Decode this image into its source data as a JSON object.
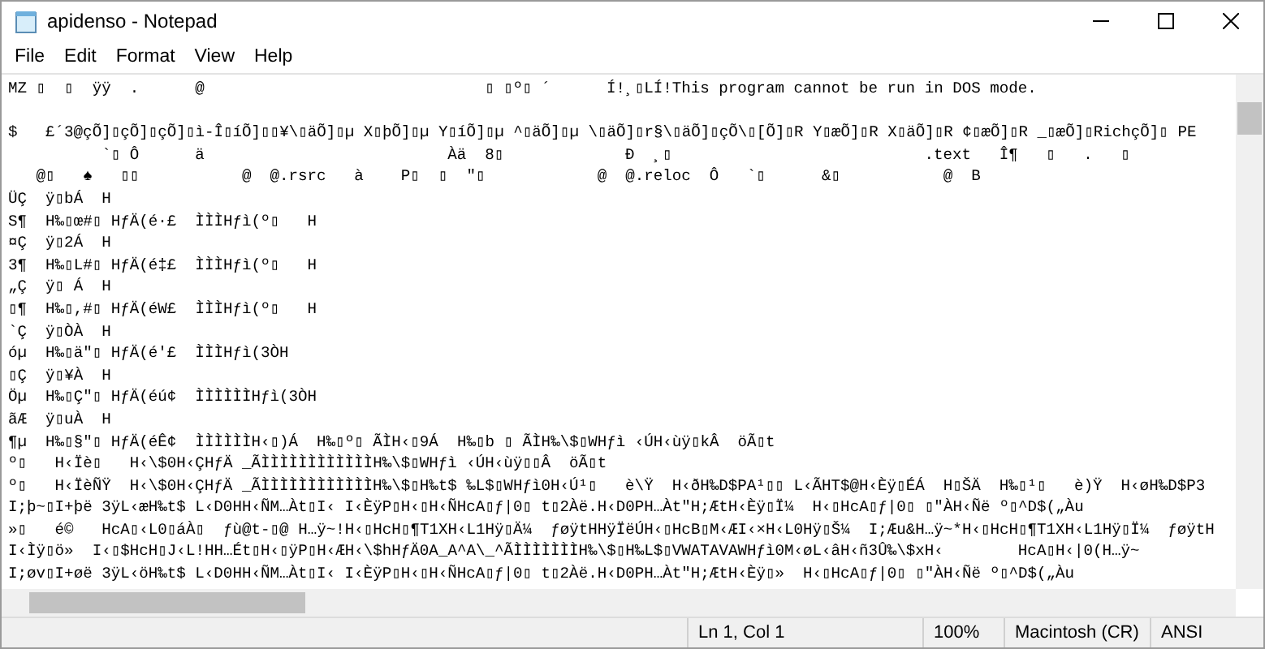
{
  "window": {
    "title": "apidenso - Notepad"
  },
  "menu": [
    "File",
    "Edit",
    "Format",
    "View",
    "Help"
  ],
  "editor": {
    "lines": [
      {
        "text": "MZ ▯  ▯  ÿÿ  .      @                              ▯ ▯º▯ ´      Í!¸▯LÍ!This program cannot be run in DOS mode.",
        "gap_after": true
      },
      {
        "text": "$   £´3@çÕ]▯çÕ]▯çÕ]▯ì-Î▯íÕ]▯▯¥\\▯äÕ]▯µ X▯þÕ]▯µ Y▯íÕ]▯µ ^▯äÕ]▯µ \\▯äÕ]▯r§\\▯äÕ]▯çÕ\\▯[Õ]▯R Y▯æÕ]▯R X▯äÕ]▯R ¢▯æÕ]▯R _▯æÕ]▯RichçÕ]▯ PE"
      },
      {
        "text": "          `▯ Ô      ä                          Àä  8▯             Ð  ¸▯                           .text   Î¶   ▯   .   ▯"
      },
      {
        "text": "   @▯   ♠   ▯▯           @  @.rsrc   à    P▯  ▯  \"▯            @  @.reloc  Ô   `▯      &▯           @  B"
      },
      {
        "text": "ÜÇ  ÿ▯bÁ  H"
      },
      {
        "text": "S¶  H‰▯œ#▯ HƒÄ(é·£  ÌÌÌHƒì(º▯   H"
      },
      {
        "text": "¤Ç  ÿ▯2Á  H"
      },
      {
        "text": "3¶  H‰▯L#▯ HƒÄ(é‡£  ÌÌÌHƒì(º▯   H"
      },
      {
        "text": "„Ç  ÿ▯ Á  H"
      },
      {
        "text": "▯¶  H‰▯,#▯ HƒÄ(éW£  ÌÌÌHƒì(º▯   H"
      },
      {
        "text": "`Ç  ÿ▯ÒÀ  H"
      },
      {
        "text": "óµ  H‰▯ä\"▯ HƒÄ(é'£  ÌÌÌHƒì(3ÒH"
      },
      {
        "text": "▯Ç  ÿ▯¥À  H"
      },
      {
        "text": "Öµ  H‰▯Ç\"▯ HƒÄ(éú¢  ÌÌÌÌÌÌHƒì(3ÒH"
      },
      {
        "text": "ãÆ  ÿ▯uÀ  H"
      },
      {
        "text": "¶µ  H‰▯§\"▯ HƒÄ(éÊ¢  ÌÌÌÌÌÌH‹▯)Á  H‰▯º▯ ÃÌH‹▯9Á  H‰▯b ▯ ÃÌH‰\\$▯WHƒì ‹ÚH‹ùÿ▯kÂ  öÃ▯t"
      },
      {
        "text": "º▯   H‹Ïè▯   H‹\\$0H‹ÇHƒÄ _ÃÌÌÌÌÌÌÌÌÌÌÌÌH‰\\$▯WHƒì ‹ÚH‹ùÿ▯▯Â  öÃ▯t"
      },
      {
        "text": "º▯   H‹ÏèÑŸ  H‹\\$0H‹ÇHƒÄ _ÃÌÌÌÌÌÌÌÌÌÌÌÌH‰\\$▯H‰t$ ‰L$▯WHƒì0H‹Ú¹▯   è\\Ÿ  H‹ðH‰D$PA¹▯▯ L‹ÃHT$@H‹Èÿ▯ÉÁ  H▯ŠÄ  H‰▯¹▯   è)Ÿ  H‹øH‰D$P3"
      },
      {
        "text": "I;þ~▯I+þë 3ÿL‹æH‰t$ L‹D0HH‹ÑM…Àt▯I‹ I‹ÈÿP▯H‹▯H‹ÑHcA▯ƒ|0▯ t▯2Àë.H‹D0PH…Àt\"H;ÆtH‹Èÿ▯Ï¼  H‹▯HcA▯ƒ|0▯ ▯\"ÀH‹Ñë º▯^D$(„Àu"
      },
      {
        "text": "»▯   é©   HcA▯‹L0▯áÀ▯  ƒù@t-▯@ H…ÿ~!H‹▯HcH▯¶T1XH‹L1Hÿ▯Ä¼  ƒøÿtHHÿÏëÚH‹▯HcB▯M‹ÆI‹×H‹L0Hÿ▯Š¼  I;Æu&H…ÿ~*H‹▯HcH▯¶T1XH‹L1Hÿ▯Ï¼  ƒøÿtH"
      },
      {
        "text": "I‹Ìÿ▯ö»  I‹▯$HcH▯J‹L!HH…Ét▯H‹▯ÿP▯H‹ÆH‹\\$hHƒÄ0A_A^A\\_^ÃÌÌÌÌÌÌÌH‰\\$▯H‰L$▯VWATAVAWHƒì0M‹øL‹âH‹ñ3Û‰\\$xH‹        HcA▯H‹|0(H…ÿ~"
      },
      {
        "text": "I;øv▯I+øë 3ÿL‹öH‰t$ L‹D0HH‹ÑM…Àt▯I‹ I‹ÈÿP▯H‹▯H‹ÑHcA▯ƒ|0▯ t▯2Àë.H‹D0PH…Àt\"H;ÆtH‹Èÿ▯»  H‹▯HcA▯ƒ|0▯ ▯\"ÀH‹Ñë º▯^D$(„Àu"
      }
    ]
  },
  "status_bar": [
    "Ln 1, Col 1",
    "100%",
    "Macintosh (CR)",
    "ANSI"
  ]
}
